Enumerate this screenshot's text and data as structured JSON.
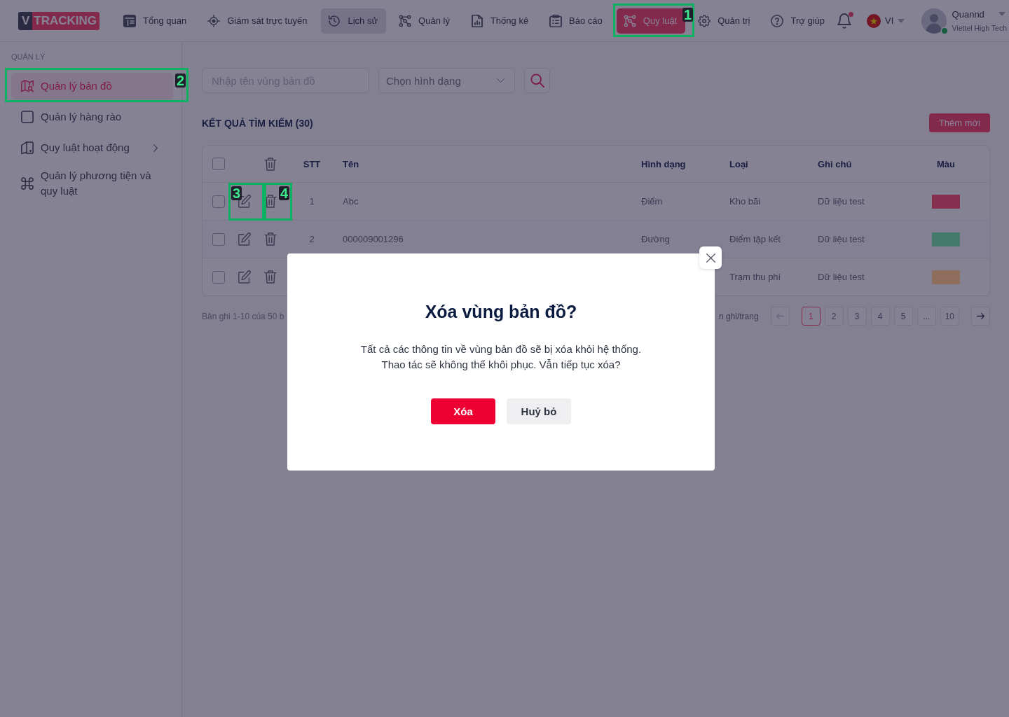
{
  "topbar": {
    "logo": {
      "mark": "V",
      "word": "TRACKING"
    },
    "nav": [
      {
        "label": "Tổng quan",
        "selected": false,
        "hovered": false
      },
      {
        "label": "Giám sát trực tuyến",
        "selected": false,
        "hovered": false
      },
      {
        "label": "Lịch sử",
        "selected": false,
        "hovered": true
      },
      {
        "label": "Quản lý",
        "selected": false,
        "hovered": false
      },
      {
        "label": "Thống kê",
        "selected": false,
        "hovered": false
      },
      {
        "label": "Báo cáo",
        "selected": false,
        "hovered": false
      },
      {
        "label": "Quy luật",
        "selected": true,
        "hovered": false,
        "callout": "1"
      },
      {
        "label": "Quản trị",
        "selected": false,
        "hovered": false
      },
      {
        "label": "Trợ giúp",
        "selected": false,
        "hovered": false
      }
    ],
    "notifications": {
      "unread": true
    },
    "language": {
      "code": "VI"
    },
    "user": {
      "name": "Quannd",
      "organization": "Viettel High Tech",
      "online": true
    }
  },
  "sidebar": {
    "section": "QUẢN LÝ",
    "items": [
      {
        "label": "Quản lý bản đồ",
        "selected": true,
        "callout": "2"
      },
      {
        "label": "Quản lý hàng rào",
        "selected": false
      },
      {
        "label": "Quy luật hoạt động",
        "selected": false,
        "expanded": false
      },
      {
        "label": "Quản lý phương tiện và quy luật",
        "selected": false
      }
    ]
  },
  "search": {
    "name_field": {
      "placeholder": "Nhập tên vùng bản đồ"
    },
    "shape_select": {
      "placeholder": "Chọn hình dạng"
    }
  },
  "results": {
    "title": "KẾT QUẢ TÌM KIẾM (30)",
    "add_button": "Thêm mới"
  },
  "table": {
    "header_checked": false,
    "columns": [
      "STT",
      "Tên",
      "Hình dạng",
      "Loại",
      "Ghi chú",
      "Màu"
    ],
    "rows": [
      {
        "checked": false,
        "stt": "1",
        "name": "Abc",
        "shape": "Điểm",
        "type": "Kho bãi",
        "note": "Dữ liệu test",
        "color": "#862f4f",
        "edit_callout": "3",
        "delete_callout": "4"
      },
      {
        "checked": false,
        "stt": "2",
        "name": "000009001296",
        "shape": "Đường",
        "type": "Điểm tập kết",
        "note": "Dữ liệu test",
        "color": "#437a69"
      },
      {
        "checked": false,
        "type": "Trạm thu phí",
        "note": "Dữ liệu test",
        "color": "#8f6d5c"
      }
    ]
  },
  "pagination": {
    "summary": "Bản ghi 1-10 của 50 b",
    "page_size": "n ghi/trang",
    "prev": {
      "disabled": true
    },
    "pages": [
      {
        "label": "1",
        "selected": true
      },
      {
        "label": "2",
        "selected": false
      },
      {
        "label": "3",
        "selected": false
      },
      {
        "label": "4",
        "selected": false
      },
      {
        "label": "5",
        "selected": false
      },
      {
        "label": "...",
        "selected": false
      },
      {
        "label": "10",
        "selected": false
      }
    ],
    "next": {
      "disabled": false
    }
  },
  "dialog": {
    "title": "Xóa vùng bản đồ?",
    "message": "Tất cả các thông tin về vùng bản đồ sẽ bị xóa khỏi hệ thống.\nThao tác sẽ không thể khôi phục. Vẫn tiếp tục xóa?",
    "confirm": "Xóa",
    "cancel": "Huỷ bỏ"
  }
}
